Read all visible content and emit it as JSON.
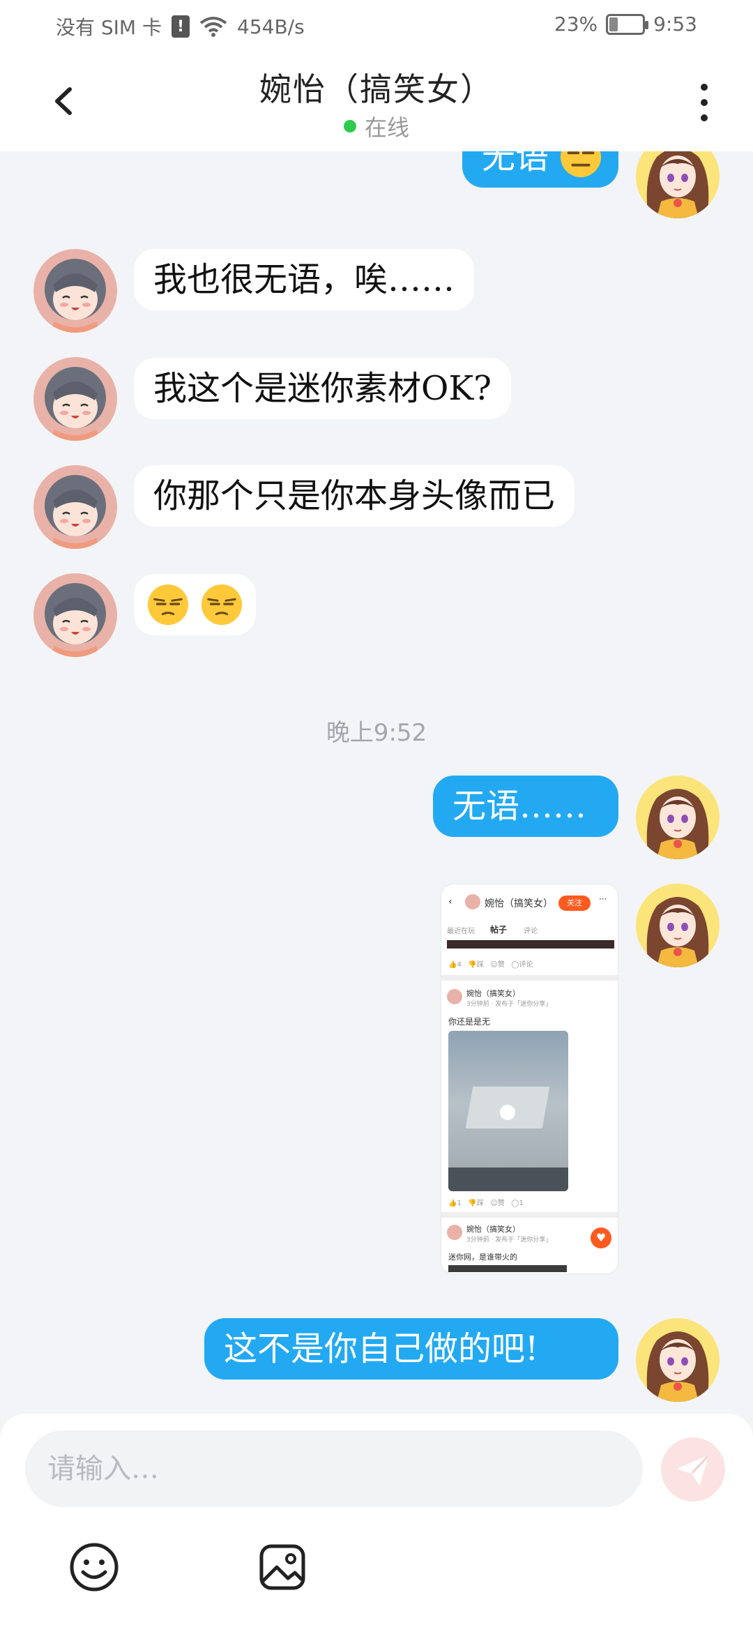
{
  "status_bar": {
    "carrier": "没有 SIM 卡",
    "alert": "!",
    "net_speed": "454B/s",
    "battery": "23%",
    "time": "9:53"
  },
  "header": {
    "title": "婉怡（搞笑女）",
    "status": "在线"
  },
  "messages": {
    "m1": "无语",
    "m2": "我也很无语，唉……",
    "m3": "我这个是迷你素材OK?",
    "m4": "你那个只是你本身头像而已",
    "timestamp": "晚上9:52",
    "m6": "无语……",
    "m8": "这不是你自己做的吧!"
  },
  "shot": {
    "title": "婉怡（搞笑女）",
    "follow": "关注",
    "tab1": "最近在玩",
    "tab2": "帖子",
    "tab3": "评论",
    "post1_name": "婉怡（搞笑女）",
    "post1_meta": "3分钟前 · 发布于「迷你分享」",
    "post1_text": "你还是是无",
    "post2_name": "婉怡（搞笑女）",
    "post2_meta": "3分钟前 · 发布于「迷你分享」",
    "post2_text": "迷你网，是谁带火的"
  },
  "input": {
    "placeholder": "请输入…"
  },
  "colors": {
    "accent_blue": "#23A9F2",
    "online_green": "#2FCB4E",
    "background": "#F3F4F7",
    "send_pink": "#FCE3E3"
  },
  "icons": [
    "back-icon",
    "more-icon",
    "unamused-emoji",
    "expressionless-emoji",
    "send-icon",
    "emoji-icon",
    "image-icon"
  ]
}
